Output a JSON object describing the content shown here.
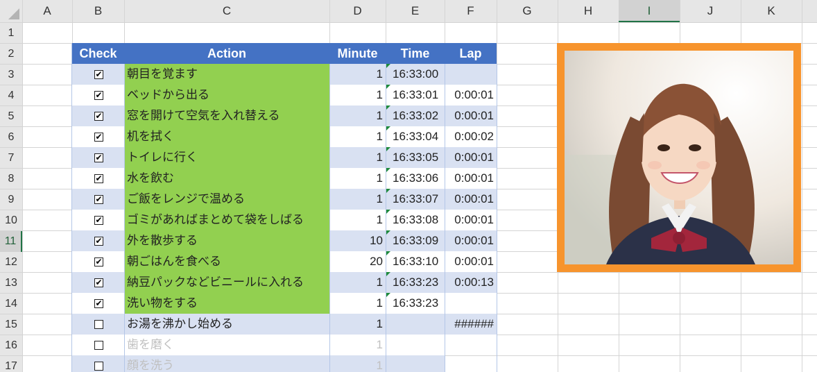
{
  "grid": {
    "columns": [
      "A",
      "B",
      "C",
      "D",
      "E",
      "F",
      "G",
      "H",
      "I",
      "J",
      "K"
    ],
    "rows": [
      "1",
      "2",
      "3",
      "4",
      "5",
      "6",
      "7",
      "8",
      "9",
      "10",
      "11",
      "12",
      "13",
      "14",
      "15",
      "16",
      "17"
    ],
    "selected_column": "I",
    "selected_row": "11"
  },
  "table": {
    "headers": {
      "check": "Check",
      "action": "Action",
      "minute": "Minute",
      "time": "Time",
      "lap": "Lap"
    },
    "rows": [
      {
        "checked": true,
        "action": "朝目を覚ます",
        "minute": "1",
        "time": "16:33:00",
        "lap": ""
      },
      {
        "checked": true,
        "action": "ベッドから出る",
        "minute": "1",
        "time": "16:33:01",
        "lap": "0:00:01"
      },
      {
        "checked": true,
        "action": "窓を開けて空気を入れ替える",
        "minute": "1",
        "time": "16:33:02",
        "lap": "0:00:01"
      },
      {
        "checked": true,
        "action": "机を拭く",
        "minute": "1",
        "time": "16:33:04",
        "lap": "0:00:02"
      },
      {
        "checked": true,
        "action": "トイレに行く",
        "minute": "1",
        "time": "16:33:05",
        "lap": "0:00:01"
      },
      {
        "checked": true,
        "action": "水を飲む",
        "minute": "1",
        "time": "16:33:06",
        "lap": "0:00:01"
      },
      {
        "checked": true,
        "action": "ご飯をレンジで温める",
        "minute": "1",
        "time": "16:33:07",
        "lap": "0:00:01"
      },
      {
        "checked": true,
        "action": "ゴミがあればまとめて袋をしばる",
        "minute": "1",
        "time": "16:33:08",
        "lap": "0:00:01"
      },
      {
        "checked": true,
        "action": "外を散歩する",
        "minute": "10",
        "time": "16:33:09",
        "lap": "0:00:01"
      },
      {
        "checked": true,
        "action": "朝ごはんを食べる",
        "minute": "20",
        "time": "16:33:10",
        "lap": "0:00:01"
      },
      {
        "checked": true,
        "action": "納豆パックなどビニールに入れる",
        "minute": "1",
        "time": "16:33:23",
        "lap": "0:00:13"
      },
      {
        "checked": true,
        "action": "洗い物をする",
        "minute": "1",
        "time": "16:33:23",
        "lap": ""
      },
      {
        "checked": false,
        "action": "お湯を沸かし始める",
        "minute": "1",
        "time": "",
        "lap": "######"
      },
      {
        "checked": false,
        "action": "歯を磨く",
        "minute": "1",
        "time": "",
        "lap": ""
      },
      {
        "checked": false,
        "action": "顔を洗う",
        "minute": "1",
        "time": "",
        "lap": ""
      }
    ]
  },
  "picture": {
    "subject": "photo-portrait",
    "frame_color": "#f7942d"
  },
  "colors": {
    "header_blue": "#4472c4",
    "band_blue": "#d9e1f2",
    "action_green": "#92d050",
    "grid_line": "#d4d4d4",
    "selection_green": "#217346"
  }
}
